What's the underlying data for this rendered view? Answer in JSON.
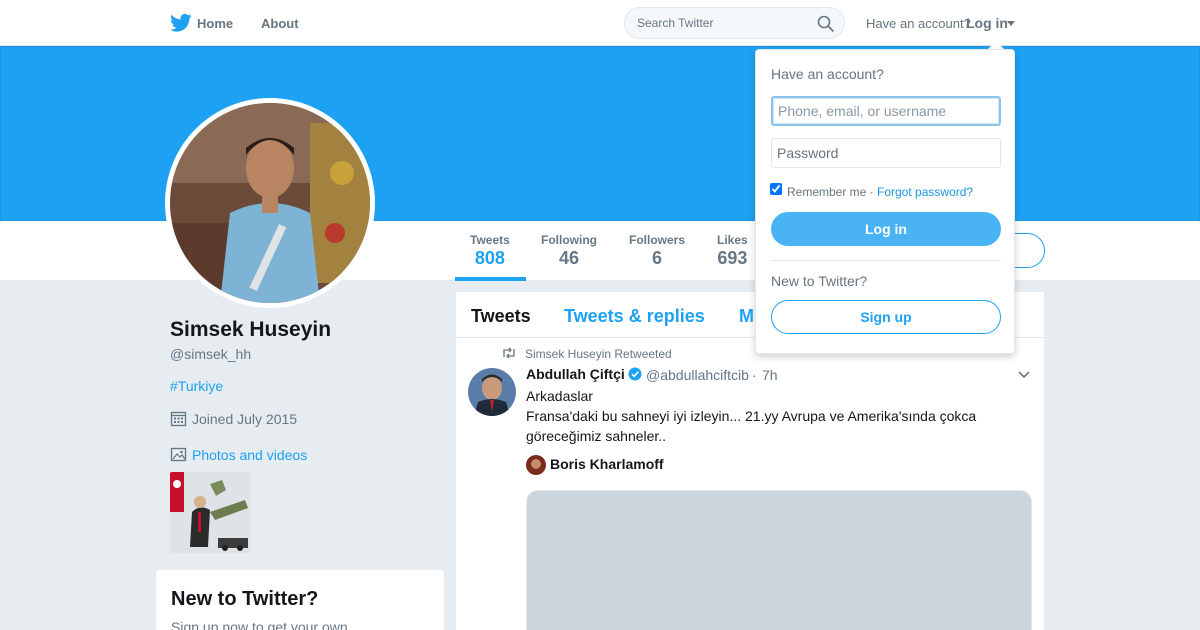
{
  "colors": {
    "brand": "#1da1f2",
    "text_secondary": "#657786"
  },
  "nav": {
    "home_label": "Home",
    "about_label": "About",
    "search_placeholder": "Search Twitter",
    "have_account": "Have an account?",
    "login_label": "Log in"
  },
  "stats": [
    {
      "label": "Tweets",
      "value": "808"
    },
    {
      "label": "Following",
      "value": "46"
    },
    {
      "label": "Followers",
      "value": "6"
    },
    {
      "label": "Likes",
      "value": "693"
    }
  ],
  "profile": {
    "name": "Simsek Huseyin",
    "handle": "@simsek_hh",
    "hashtag": "#Turkiye",
    "joined": "Joined July 2015",
    "photos_label": "Photos and videos"
  },
  "signup_card": {
    "title": "New to Twitter?",
    "text": "Sign up now to get your own"
  },
  "timeline": {
    "tabs": [
      "Tweets",
      "Tweets & replies",
      "M"
    ]
  },
  "tweet": {
    "retweeted_by": "Simsek Huseyin Retweeted",
    "author_name": "Abdullah Çiftçi",
    "author_handle": "@abdullahciftcib",
    "separator": "·",
    "time": "7h",
    "text": "Arkadaslar\nFransa'daki bu sahneyi iyi izleyin... 21.yy Avrupa ve Amerika'sında çokca göreceğimiz sahneler..",
    "quoted_name": "Boris Kharlamoff"
  },
  "login_dropdown": {
    "title": "Have an account?",
    "username_placeholder": "Phone, email, or username",
    "password_placeholder": "Password",
    "remember_label": "Remember me ·",
    "forgot_label": "Forgot password?",
    "login_button": "Log in",
    "new_to_twitter": "New to Twitter?",
    "signup_button": "Sign up"
  }
}
